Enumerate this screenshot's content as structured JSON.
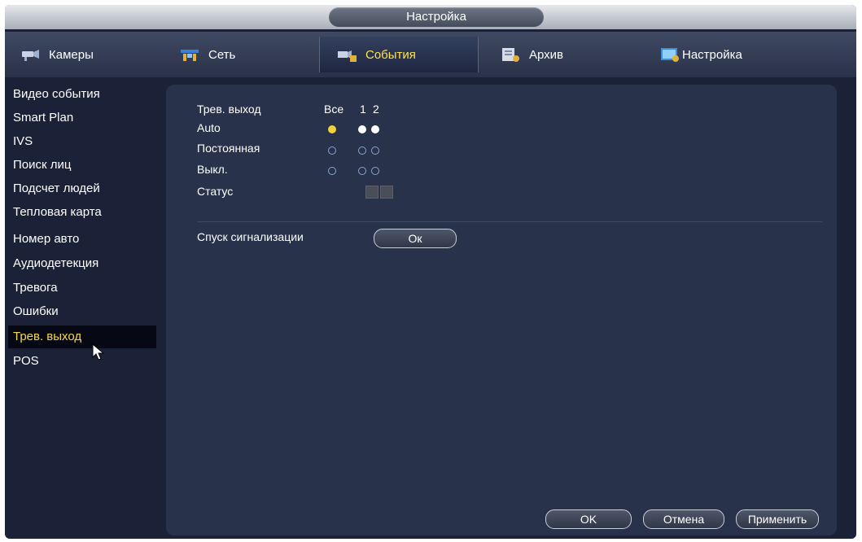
{
  "window": {
    "title": "Настройка"
  },
  "tabs": [
    {
      "label": "Камеры",
      "icon": "camera-icon"
    },
    {
      "label": "Сеть",
      "icon": "network-icon"
    },
    {
      "label": "События",
      "icon": "events-icon",
      "active": true
    },
    {
      "label": "Архив",
      "icon": "archive-icon"
    },
    {
      "label": "Настройка",
      "icon": "settings-icon"
    }
  ],
  "sidebar": {
    "items": [
      {
        "label": "Видео события"
      },
      {
        "label": "Smart Plan"
      },
      {
        "label": "IVS"
      },
      {
        "label": "Поиск лиц"
      },
      {
        "label": "Подсчет людей"
      },
      {
        "label": "Тепловая карта"
      },
      {
        "label": "Номер авто"
      },
      {
        "label": "Аудиодетекция"
      },
      {
        "label": "Тревога"
      },
      {
        "label": "Ошибки"
      },
      {
        "label": "Трев. выход",
        "active": true
      },
      {
        "label": "POS"
      }
    ]
  },
  "alarm_output": {
    "header_label": "Трев. выход",
    "all_label": "Все",
    "channels": [
      "1",
      "2"
    ],
    "modes": [
      {
        "label": "Auto",
        "all_selected": true,
        "ch1_selected": true,
        "ch2_selected": true
      },
      {
        "label": "Постоянная",
        "all_selected": false,
        "ch1_selected": false,
        "ch2_selected": false
      },
      {
        "label": "Выкл.",
        "all_selected": false,
        "ch1_selected": false,
        "ch2_selected": false
      }
    ],
    "status_label": "Статус",
    "alarm_release_label": "Спуск сигнализации",
    "alarm_release_button": "Ок"
  },
  "footer": {
    "ok": "OK",
    "cancel": "Отмена",
    "apply": "Применить"
  },
  "colors": {
    "accent": "#f7d748",
    "background": "#1b2238",
    "panel": "#28324a"
  }
}
